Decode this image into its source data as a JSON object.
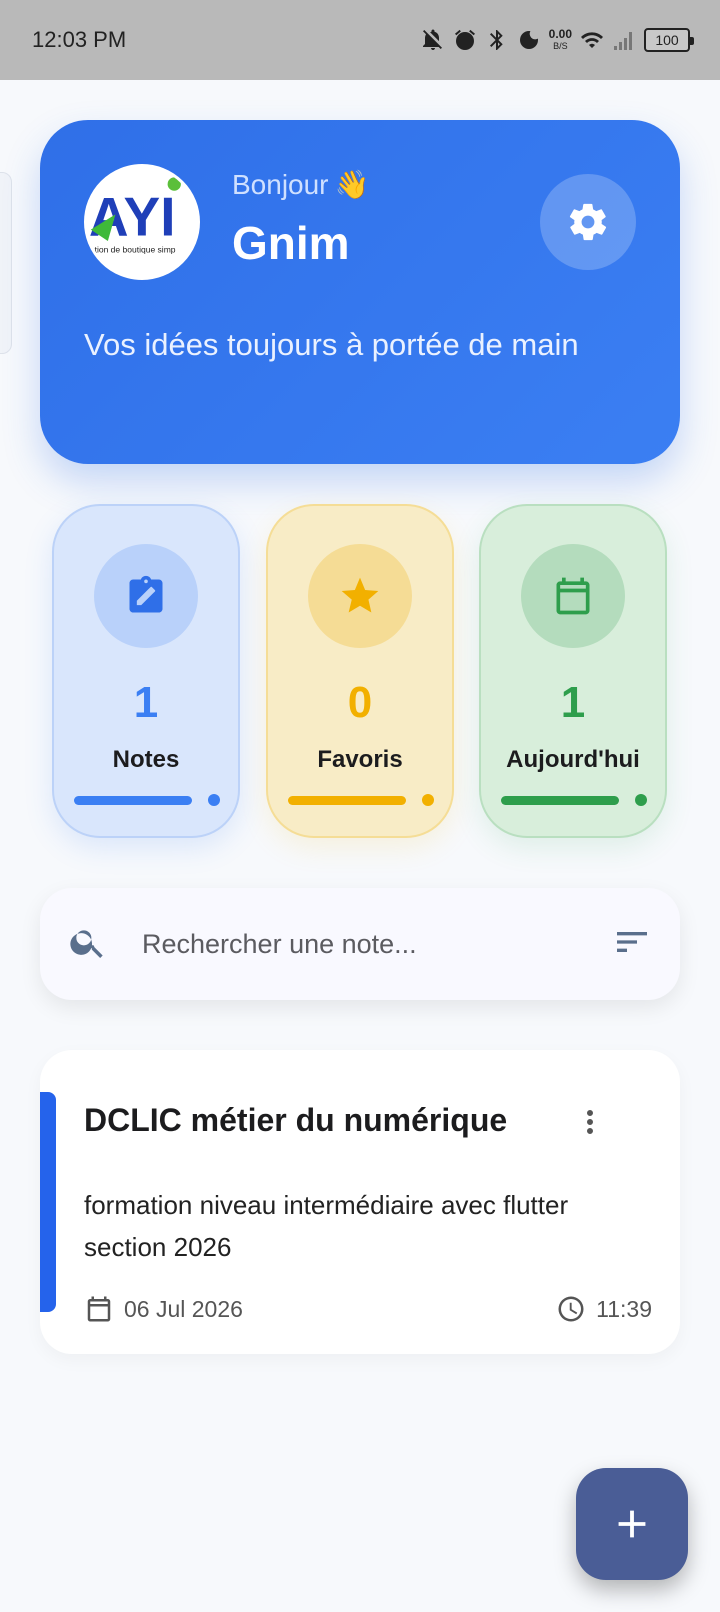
{
  "status_bar": {
    "time": "12:03 PM",
    "net_speed_value": "0.00",
    "net_speed_unit": "B/S",
    "battery": "100"
  },
  "header": {
    "greeting": "Bonjour",
    "greeting_emoji": "👋",
    "user_name": "Gnim",
    "tagline": "Vos idées toujours à portée de main",
    "logo_text": "tion de boutique simp",
    "settings_icon": "gear-icon"
  },
  "stats": [
    {
      "label": "Notes",
      "value": "1",
      "icon": "note-edit-icon",
      "color": "#3b7ff3"
    },
    {
      "label": "Favoris",
      "value": "0",
      "icon": "star-icon",
      "color": "#f2b000"
    },
    {
      "label": "Aujourd'hui",
      "value": "1",
      "icon": "calendar-icon",
      "color": "#2e9e4c"
    }
  ],
  "search": {
    "placeholder": "Rechercher une note...",
    "value": ""
  },
  "notes": [
    {
      "title": "DCLIC métier du numérique",
      "content": "formation niveau intermédiaire avec flutter section 2026",
      "date": "06 Jul 2026",
      "time": "11:39",
      "accent_color": "#2563eb"
    }
  ],
  "colors": {
    "primary": "#3b7ff3",
    "fab": "#4a5d96",
    "background": "#f7f9fc"
  }
}
